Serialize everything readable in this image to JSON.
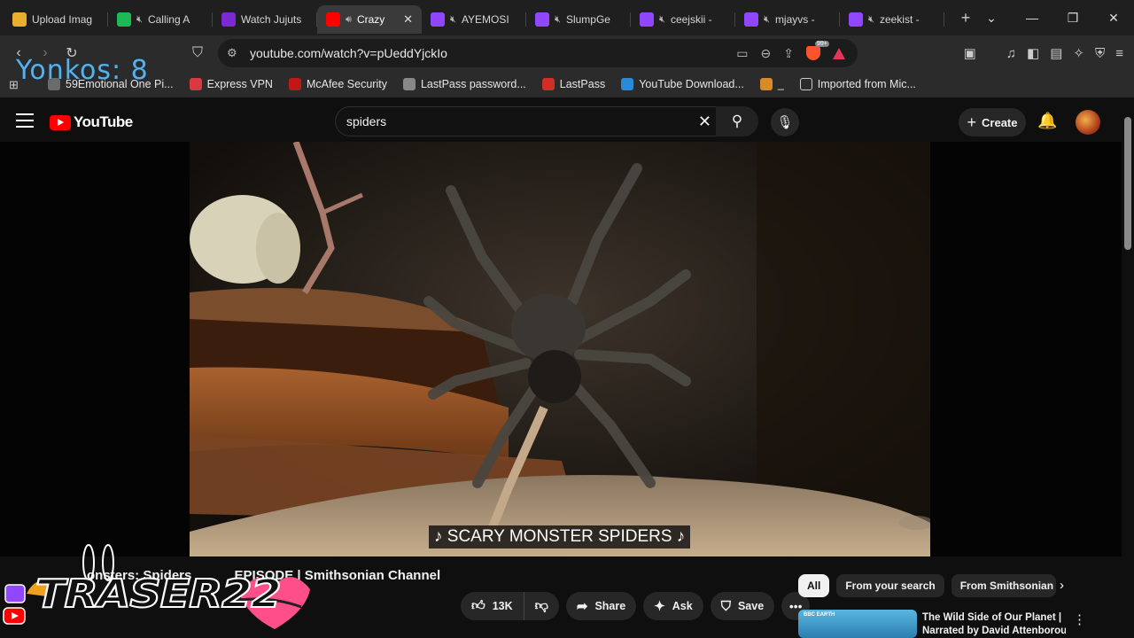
{
  "browser": {
    "tabs": [
      {
        "title": "Upload Imag",
        "muted": false,
        "fav_color": "#e8b02c",
        "icon": "upload-icon"
      },
      {
        "title": "Calling A",
        "muted": true,
        "fav_color": "#1db954",
        "icon": "spotify-icon"
      },
      {
        "title": "Watch Jujuts",
        "muted": false,
        "fav_color": "#7a2ad0",
        "icon": "play-triangle-icon"
      },
      {
        "title": "Crazy",
        "muted": false,
        "fav_color": "#ff0000",
        "icon": "youtube-icon",
        "active": true
      },
      {
        "title": "AYEMOSI",
        "muted": true,
        "fav_color": "#9146ff",
        "icon": "twitch-icon"
      },
      {
        "title": "SlumpGe",
        "muted": true,
        "fav_color": "#9146ff",
        "icon": "twitch-icon"
      },
      {
        "title": "ceejskii -",
        "muted": true,
        "fav_color": "#9146ff",
        "icon": "twitch-icon"
      },
      {
        "title": "mjayvs -",
        "muted": true,
        "fav_color": "#9146ff",
        "icon": "twitch-icon"
      },
      {
        "title": "zeekist -",
        "muted": true,
        "fav_color": "#9146ff",
        "icon": "twitch-icon"
      }
    ],
    "new_tab": "+",
    "url": "youtube.com/watch?v=pUeddYjckIo",
    "brave_badge": "99+",
    "bookmarks": [
      {
        "label": "59Emotional One Pi...",
        "color": "#6b6b6b"
      },
      {
        "label": "Express VPN",
        "color": "#da3940"
      },
      {
        "label": "McAfee Security",
        "color": "#c01818"
      },
      {
        "label": "LastPass password...",
        "color": "#888888"
      },
      {
        "label": "LastPass",
        "color": "#d32d27"
      },
      {
        "label": "YouTube Download...",
        "color": "#2a8ad6"
      },
      {
        "label": "_",
        "color": "#d8892a"
      },
      {
        "label": "Imported from Mic...",
        "color": "#2b2b2b"
      }
    ]
  },
  "overlay": {
    "counter_text": "Yonkos: 8",
    "streamer_name": "TRASER22"
  },
  "youtube": {
    "logo_text": "YouTube",
    "search_value": "spiders",
    "create_label": "Create",
    "caption": "♪ SCARY MONSTER SPIDERS ♪",
    "video_title": "2. Monsters: Spiders ... FULL EPISODE | Smithsonian Channel",
    "video_title_visible": "onsters: Spiders",
    "video_title_rest": "| Smithsonian Channel",
    "video_title_mid": "EPISODE",
    "likes": "13K",
    "share_label": "Share",
    "ask_label": "Ask",
    "save_label": "Save",
    "chips": [
      "All",
      "From your search",
      "From Smithsonian Char"
    ],
    "reco": {
      "title_line1": "The Wild Side of Our Planet |",
      "title_line2": "Narrated by David Attenborou...",
      "thumb_tag": "BBC EARTH"
    }
  }
}
